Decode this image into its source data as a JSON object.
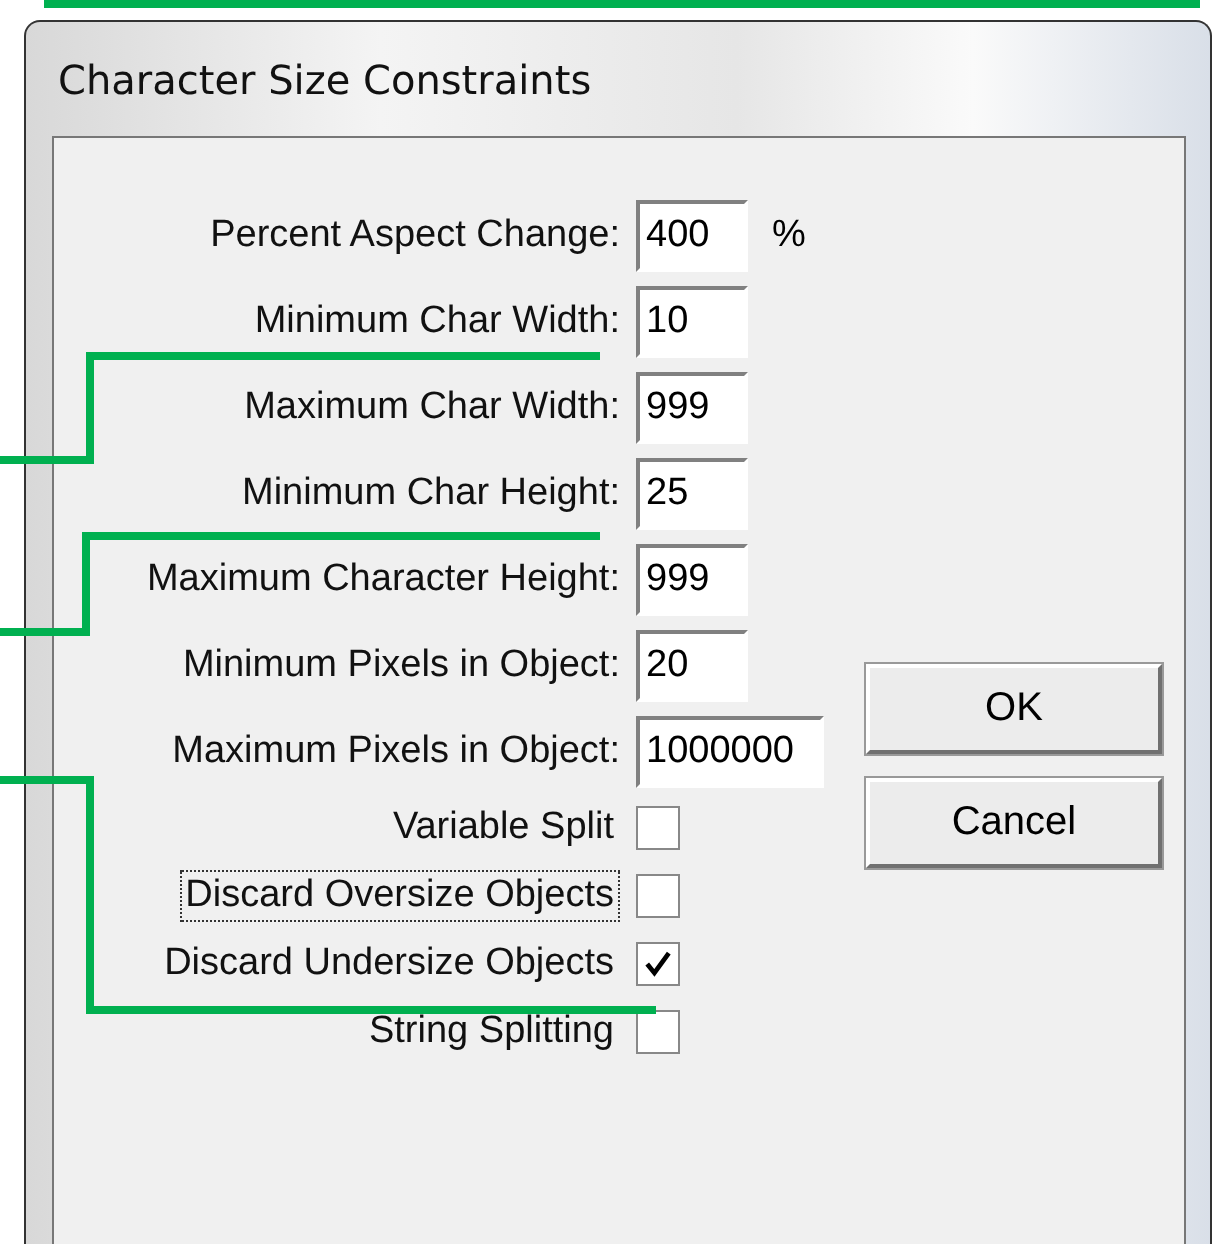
{
  "window": {
    "title": "Character Size Constraints"
  },
  "fields": [
    {
      "label": "Percent Aspect Change:",
      "value": "400",
      "unit": "%"
    },
    {
      "label": "Minimum Char Width:",
      "value": "10"
    },
    {
      "label": "Maximum Char Width:",
      "value": "999"
    },
    {
      "label": "Minimum Char Height:",
      "value": "25"
    },
    {
      "label": "Maximum Character Height:",
      "value": "999"
    },
    {
      "label": "Minimum Pixels in Object:",
      "value": "20"
    },
    {
      "label": "Maximum Pixels in Object:",
      "value": "1000000"
    }
  ],
  "checkboxes": [
    {
      "label": "Variable Split",
      "checked": false,
      "focused": false
    },
    {
      "label": "Discard Oversize Objects",
      "checked": false,
      "focused": true
    },
    {
      "label": "Discard Undersize Objects",
      "checked": true,
      "focused": false
    },
    {
      "label": "String Splitting",
      "checked": false,
      "focused": false
    }
  ],
  "buttons": [
    "OK",
    "Cancel"
  ]
}
